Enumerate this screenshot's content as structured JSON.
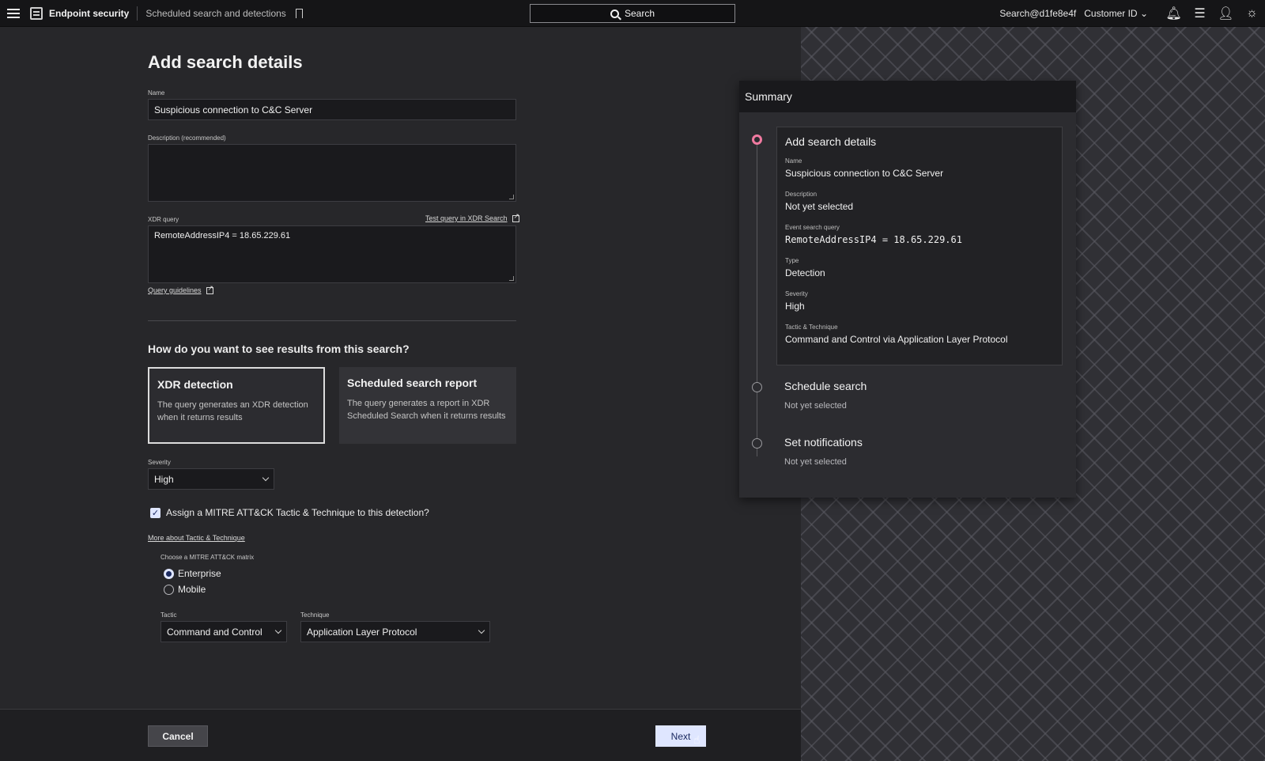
{
  "topbar": {
    "app_title": "Endpoint security",
    "breadcrumb": "Scheduled search and detections",
    "search_label": "Search",
    "user": "Search@d1fe8e4f",
    "customer": "Customer ID"
  },
  "form": {
    "title": "Add search details",
    "name_label": "Name",
    "name_value": "Suspicious connection to C&C Server",
    "description_label": "Description (recommended)",
    "description_value": "",
    "query_label": "XDR query",
    "test_query_link": "Test query in XDR Search",
    "query_value": "RemoteAddressIP4 = 18.65.229.61",
    "guidelines_link": "Query guidelines",
    "results_question": "How do you want to see results from this search?",
    "cards": [
      {
        "title": "XDR detection",
        "desc": "The query generates an XDR detection when it returns results",
        "selected": true
      },
      {
        "title": "Scheduled search report",
        "desc": "The query generates a report in XDR Scheduled Search when it returns results",
        "selected": false
      }
    ],
    "severity_label": "Severity",
    "severity_value": "High",
    "mitre_checkbox_label": "Assign a MITRE ATT&CK Tactic & Technique to this detection?",
    "mitre_checked": true,
    "more_link": "More about Tactic & Technique",
    "matrix_label": "Choose a MITRE ATT&CK matrix",
    "matrix_options": [
      "Enterprise",
      "Mobile"
    ],
    "matrix_selected": "Enterprise",
    "tactic_label": "Tactic",
    "tactic_value": "Command and Control",
    "technique_label": "Technique",
    "technique_value": "Application Layer Protocol"
  },
  "footer": {
    "cancel_label": "Cancel",
    "next_label": "Next"
  },
  "summary": {
    "title": "Summary",
    "step1": {
      "title": "Add search details",
      "name_label": "Name",
      "name_value": "Suspicious connection to C&C Server",
      "desc_label": "Description",
      "desc_value": "Not yet selected",
      "query_label": "Event search query",
      "query_value": "RemoteAddressIP4 = 18.65.229.61",
      "type_label": "Type",
      "type_value": "Detection",
      "severity_label": "Severity",
      "severity_value": "High",
      "tt_label": "Tactic & Technique",
      "tt_value": "Command and Control via Application Layer Protocol"
    },
    "step2": {
      "title": "Schedule search",
      "status": "Not yet selected"
    },
    "step3": {
      "title": "Set notifications",
      "status": "Not yet selected"
    }
  },
  "colors": {
    "accent": "#dfe6ff",
    "active_step": "#f07aa0",
    "background": "#27272a"
  },
  "icons": [
    "menu-icon",
    "app-icon",
    "bookmark-icon",
    "search-icon",
    "chevron-down-icon",
    "bell-icon",
    "news-icon",
    "user-icon",
    "theme-icon",
    "external-link-icon",
    "check-icon",
    "cursor-hand-icon"
  ]
}
